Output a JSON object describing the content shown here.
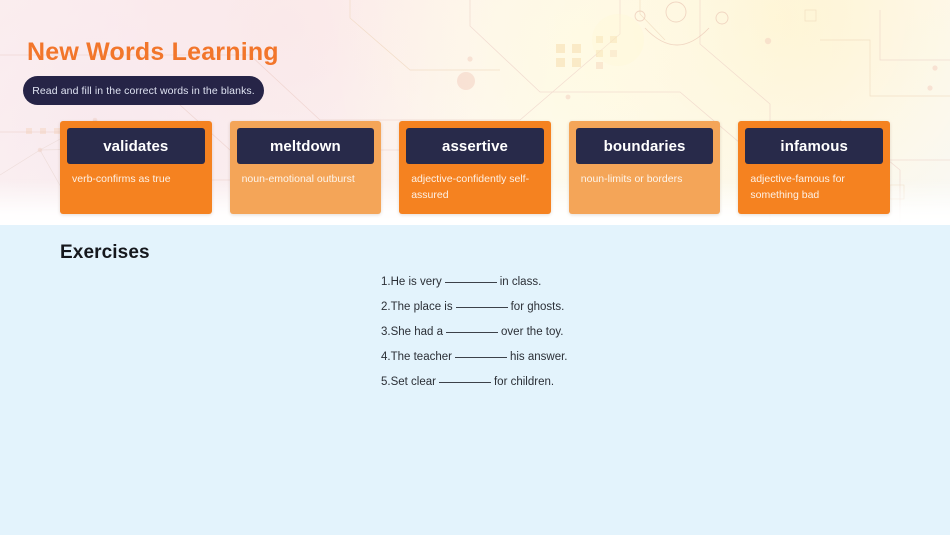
{
  "header": {
    "title": "New Words Learning",
    "instruction": "Read and fill in the correct words in the blanks.",
    "title_color": "#f2762b",
    "pill_color": "#262447"
  },
  "cards": [
    {
      "word": "validates",
      "definition": "verb-confirms as true",
      "shade": "#f58220"
    },
    {
      "word": "meltdown",
      "definition": "noun-emotional outburst",
      "shade": "#f4a558"
    },
    {
      "word": "assertive",
      "definition": "adjective-confidently self-assured",
      "shade": "#f58220"
    },
    {
      "word": "boundaries",
      "definition": "noun-limits or borders",
      "shade": "#f4a558"
    },
    {
      "word": "infamous",
      "definition": "adjective-famous for something bad",
      "shade": "#f58220"
    }
  ],
  "exercises": {
    "heading": "Exercises",
    "items": [
      {
        "number": "1.",
        "before": "He is very",
        "after": "in class."
      },
      {
        "number": "2.",
        "before": "The place is",
        "after": "for ghosts."
      },
      {
        "number": "3.",
        "before": "She had a",
        "after": "over the toy."
      },
      {
        "number": "4.",
        "before": "The teacher",
        "after": "his answer."
      },
      {
        "number": "5.",
        "before": "Set clear",
        "after": "for children."
      }
    ]
  },
  "colors": {
    "panel_background": "#e3f3fc",
    "card_header": "#282a4a",
    "accent_orange": "#f2762b"
  }
}
